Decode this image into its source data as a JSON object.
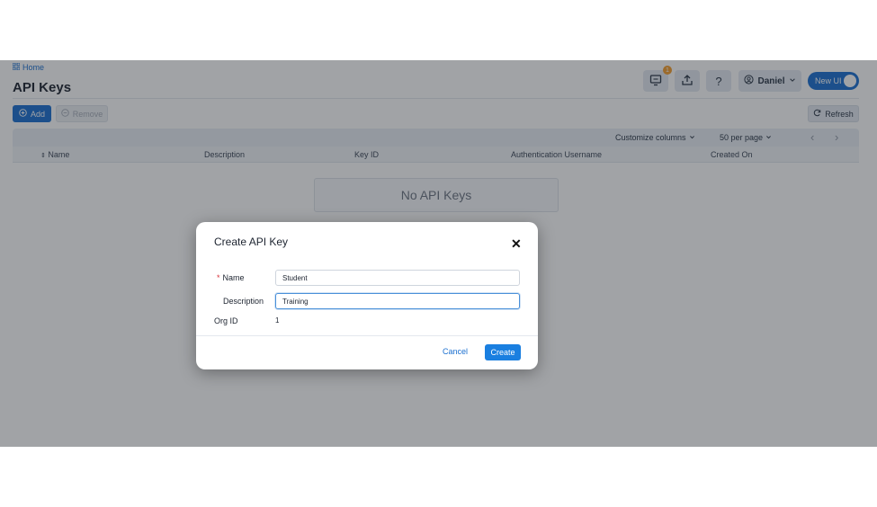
{
  "breadcrumb": {
    "home_label": "Home"
  },
  "page": {
    "title": "API Keys"
  },
  "header": {
    "notifications_badge": "1",
    "help_label": "?",
    "user_name": "Daniel",
    "new_ui_label": "New UI"
  },
  "toolbar": {
    "add_label": "Add",
    "remove_label": "Remove",
    "refresh_label": "Refresh"
  },
  "table": {
    "customize_columns_label": "Customize columns",
    "per_page_label": "50 per page",
    "columns": [
      "Name",
      "Description",
      "Key ID",
      "Authentication Username",
      "Created On"
    ],
    "empty_message": "No API Keys"
  },
  "modal": {
    "title": "Create API Key",
    "name_label": "Name",
    "name_value": "Student",
    "description_label": "Description",
    "description_value": "Training",
    "org_id_label": "Org ID",
    "org_id_value": "1",
    "cancel_label": "Cancel",
    "create_label": "Create"
  },
  "colors": {
    "accent": "#1a6fd0",
    "badge": "#f59e2b",
    "required": "#d8333a"
  },
  "icons": [
    "grid-icon",
    "monitor-icon",
    "upload-icon",
    "user-circle-icon",
    "chevron-down-icon",
    "plus-circle-icon",
    "minus-circle-icon",
    "refresh-icon",
    "chevron-left-icon",
    "chevron-right-icon",
    "sort-icon",
    "close-icon"
  ]
}
